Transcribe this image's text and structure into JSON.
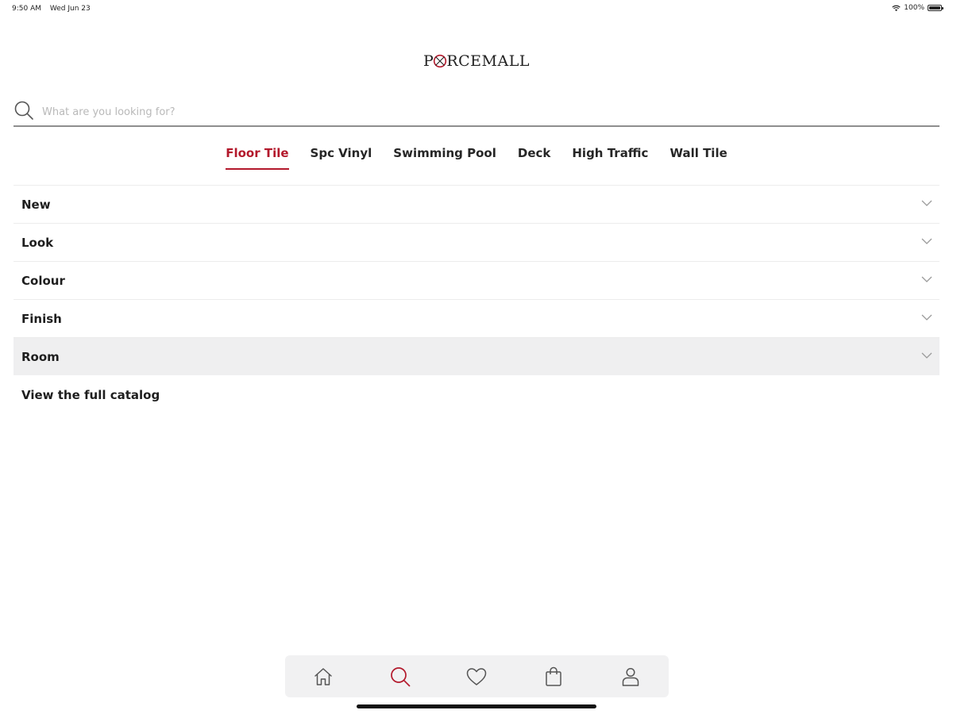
{
  "status_bar": {
    "time": "9:50 AM",
    "date": "Wed Jun 23",
    "battery": "100%",
    "battery_level": 1.0,
    "wifi_icon": "wifi-icon"
  },
  "header": {
    "logo_text_before": "P",
    "logo_text_after": "RCEMALL",
    "logo_icon": "logo-o-mark-icon"
  },
  "search": {
    "placeholder": "What are you looking for?",
    "value": "",
    "icon": "search-icon"
  },
  "categories": [
    {
      "label": "Floor Tile",
      "active": true
    },
    {
      "label": "Spc Vinyl",
      "active": false
    },
    {
      "label": "Swimming Pool",
      "active": false
    },
    {
      "label": "Deck",
      "active": false
    },
    {
      "label": "High Traffic",
      "active": false
    },
    {
      "label": "Wall Tile",
      "active": false
    }
  ],
  "filters": [
    {
      "label": "New"
    },
    {
      "label": "Look"
    },
    {
      "label": "Colour"
    },
    {
      "label": "Finish"
    },
    {
      "label": "Room",
      "highlighted": true
    }
  ],
  "catalog_link": "View the full catalog",
  "tabbar": [
    {
      "name": "home",
      "icon": "home-icon",
      "active": false
    },
    {
      "name": "search",
      "icon": "search-icon",
      "active": true
    },
    {
      "name": "favorites",
      "icon": "heart-icon",
      "active": false
    },
    {
      "name": "cart",
      "icon": "shopping-bag-icon",
      "active": false
    },
    {
      "name": "account",
      "icon": "user-icon",
      "active": false
    }
  ],
  "colors": {
    "accent": "#b3192c",
    "text": "#1e1e1e",
    "icon": "#555555",
    "tabbar_bg": "#f1f1f2",
    "highlight_row": "#efeff0"
  }
}
